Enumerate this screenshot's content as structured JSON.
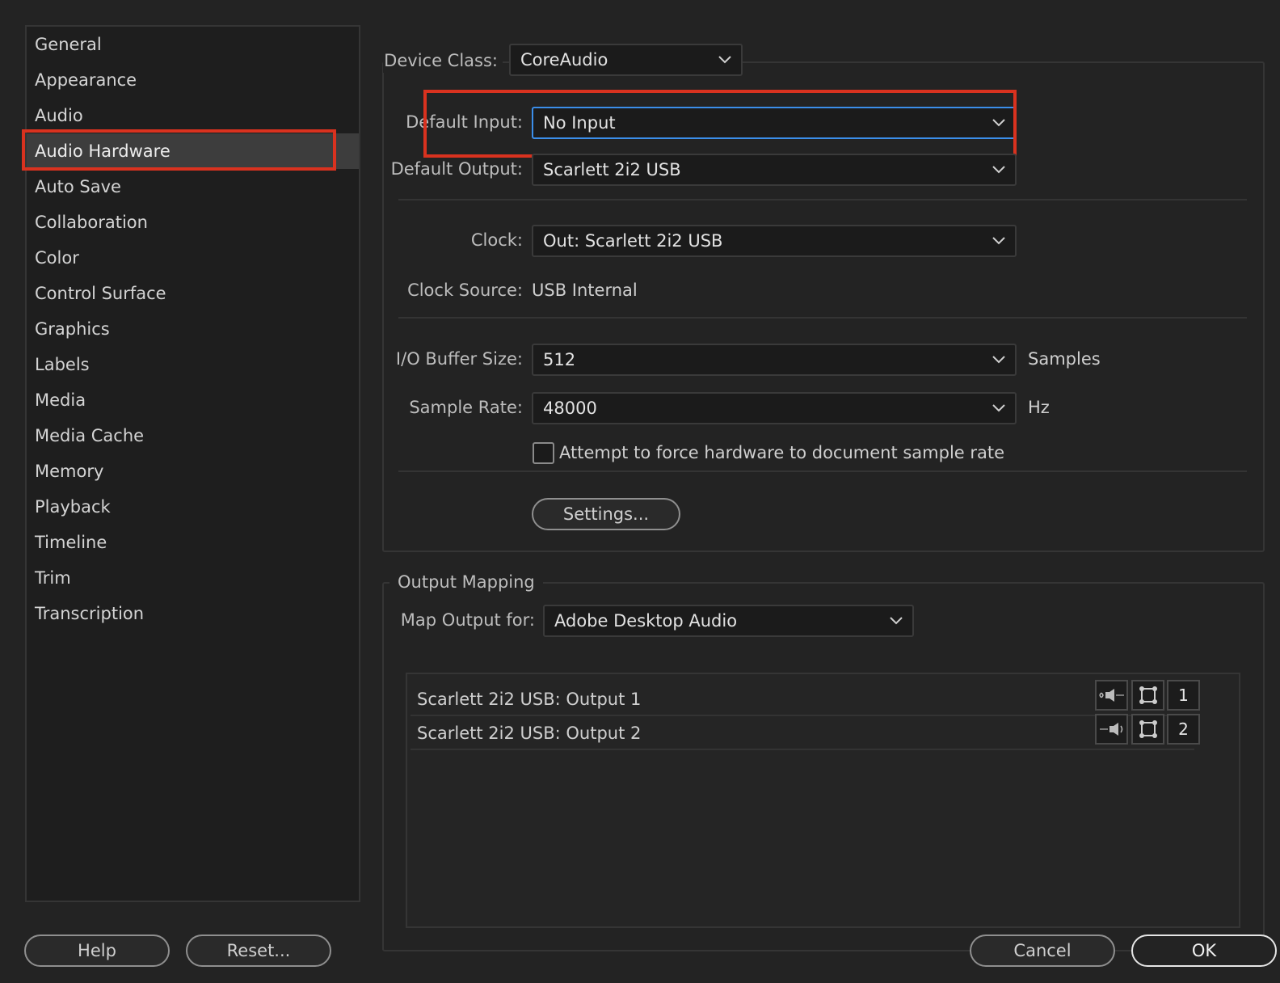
{
  "sidebar": {
    "items": [
      {
        "label": "General"
      },
      {
        "label": "Appearance"
      },
      {
        "label": "Audio"
      },
      {
        "label": "Audio Hardware"
      },
      {
        "label": "Auto Save"
      },
      {
        "label": "Collaboration"
      },
      {
        "label": "Color"
      },
      {
        "label": "Control Surface"
      },
      {
        "label": "Graphics"
      },
      {
        "label": "Labels"
      },
      {
        "label": "Media"
      },
      {
        "label": "Media Cache"
      },
      {
        "label": "Memory"
      },
      {
        "label": "Playback"
      },
      {
        "label": "Timeline"
      },
      {
        "label": "Trim"
      },
      {
        "label": "Transcription"
      }
    ],
    "selected": "Audio Hardware"
  },
  "device": {
    "device_class_label": "Device Class:",
    "device_class_value": "CoreAudio",
    "default_input_label": "Default Input:",
    "default_input_value": "No Input",
    "default_output_label": "Default Output:",
    "default_output_value": "Scarlett 2i2 USB",
    "clock_label": "Clock:",
    "clock_value": "Out: Scarlett 2i2 USB",
    "clock_source_label": "Clock Source:",
    "clock_source_value": "USB Internal",
    "buffer_label": "I/O Buffer Size:",
    "buffer_value": "512",
    "buffer_unit": "Samples",
    "sample_rate_label": "Sample Rate:",
    "sample_rate_value": "48000",
    "sample_rate_unit": "Hz",
    "force_rate_label": "Attempt to force hardware to document sample rate",
    "settings_button": "Settings..."
  },
  "output_mapping": {
    "title": "Output Mapping",
    "map_label": "Map Output for:",
    "map_value": "Adobe Desktop Audio",
    "rows": [
      {
        "label": "Scarlett 2i2 USB: Output 1",
        "channel": "1"
      },
      {
        "label": "Scarlett 2i2 USB: Output 2",
        "channel": "2"
      }
    ]
  },
  "footer": {
    "help": "Help",
    "reset": "Reset...",
    "cancel": "Cancel",
    "ok": "OK"
  },
  "colors": {
    "highlight": "#d9321f",
    "focus": "#3b8eea"
  }
}
